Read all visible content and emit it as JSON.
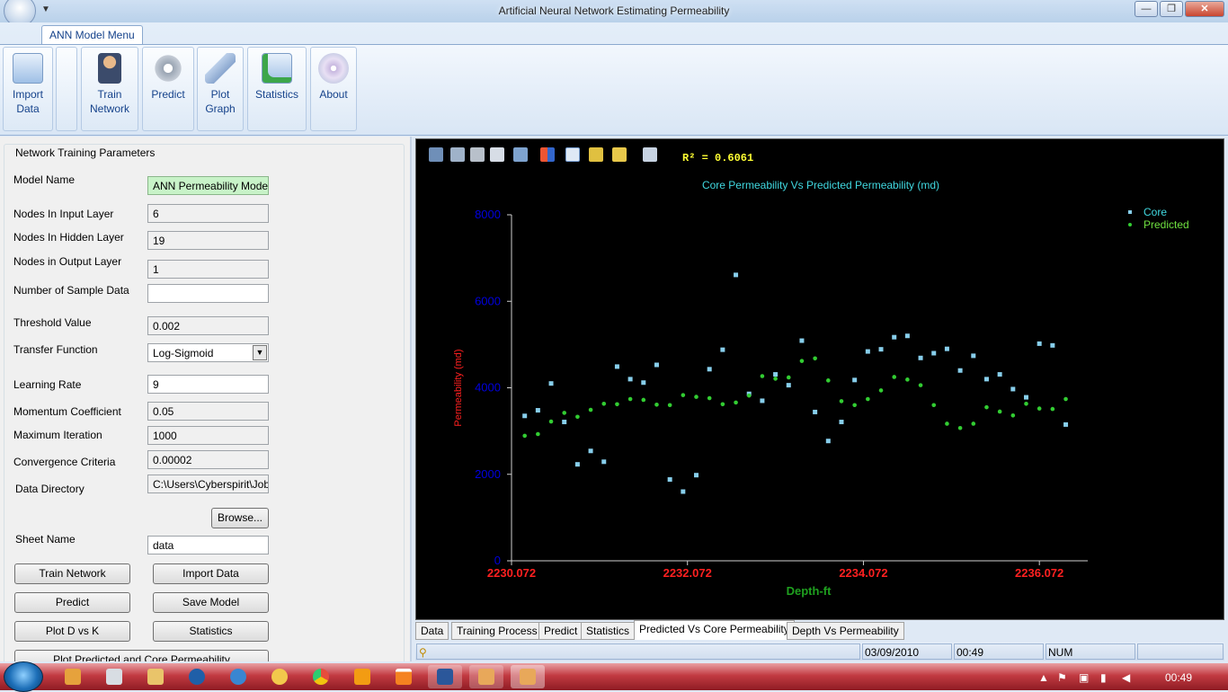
{
  "window": {
    "title": "Artificial Neural Network Estimating Permeability",
    "qat": "▼",
    "minimize": "—",
    "maximize": "❐",
    "close": "✕"
  },
  "ribbon": {
    "tab_label": "ANN Model Menu",
    "buttons": [
      {
        "label": "Import\nData",
        "icon": "envelope-icon"
      },
      {
        "label": "",
        "icon": ""
      },
      {
        "label": "Train\nNetwork",
        "icon": "person-icon"
      },
      {
        "label": "Predict",
        "icon": "gear-icon"
      },
      {
        "label": "Plot\nGraph",
        "icon": "usb-drive-icon"
      },
      {
        "label": "Statistics",
        "icon": "mail-upload-icon"
      },
      {
        "label": "About",
        "icon": "disc-icon"
      }
    ]
  },
  "params": {
    "group_title": "Network Training Parameters",
    "model_name": {
      "label": "Model Name",
      "value": "ANN Permeability Model"
    },
    "input_layer": {
      "label": "Nodes In Input Layer",
      "value": "6"
    },
    "hidden_layer": {
      "label": "Nodes In Hidden Layer",
      "value": "19"
    },
    "output_layer": {
      "label": "Nodes in Output Layer",
      "value": "1"
    },
    "sample_data": {
      "label": "Number of  Sample Data",
      "value": ""
    },
    "threshold": {
      "label": "Threshold Value",
      "value": "0.002"
    },
    "transfer": {
      "label": "Transfer Function",
      "value": "Log-Sigmoid"
    },
    "learning_rate": {
      "label": "Learning Rate",
      "value": "9"
    },
    "momentum": {
      "label": "Momentum Coefficient",
      "value": "0.05"
    },
    "max_iter": {
      "label": "Maximum Iteration",
      "value": "1000"
    },
    "convergence": {
      "label": "Convergence Criteria",
      "value": "0.00002"
    },
    "data_dir": {
      "label": "Data Directory",
      "value": "C:\\Users\\Cyberspirit\\Job"
    },
    "browse": "Browse...",
    "sheet_name": {
      "label": "Sheet Name",
      "value": "data"
    },
    "buttons": {
      "train": "Train Network",
      "import": "Import Data",
      "predict": "Predict",
      "save": "Save Model",
      "plot": "Plot D vs K",
      "statistics": "Statistics",
      "plot_predicted": "Plot Predicted and Core Permeability"
    }
  },
  "chart_header": {
    "r2": "R² = 0.6061",
    "title": "Core Permeability Vs Predicted Permeability (md)"
  },
  "chart_data": {
    "type": "scatter",
    "title": "Core Permeability Vs Predicted Permeability (md)",
    "xlabel": "Depth-ft",
    "ylabel": "Permeability (md)",
    "xlim": [
      2230.072,
      2236.622
    ],
    "ylim": [
      0,
      8000
    ],
    "xticks": [
      "2230.072",
      "2232.072",
      "2234.072",
      "2236.072"
    ],
    "yticks": [
      "0",
      "2000",
      "4000",
      "6000",
      "8000"
    ],
    "legend_position": "top-right",
    "series": [
      {
        "name": "Core",
        "color": "#87ceeb",
        "marker": "square",
        "x": [
          2230.222,
          2230.372,
          2230.522,
          2230.672,
          2230.822,
          2230.972,
          2231.122,
          2231.272,
          2231.422,
          2231.572,
          2231.722,
          2231.872,
          2232.022,
          2232.172,
          2232.322,
          2232.472,
          2232.622,
          2232.772,
          2232.922,
          2233.072,
          2233.222,
          2233.372,
          2233.522,
          2233.672,
          2233.822,
          2233.972,
          2234.122,
          2234.272,
          2234.422,
          2234.572,
          2234.722,
          2234.872,
          2235.022,
          2235.172,
          2235.322,
          2235.472,
          2235.622,
          2235.772,
          2235.922,
          2236.072,
          2236.222,
          2236.372
        ],
        "y": [
          3350,
          3480,
          4100,
          3210,
          2230,
          2540,
          2290,
          4490,
          4200,
          4120,
          4530,
          1880,
          1600,
          1980,
          4430,
          4880,
          6610,
          3860,
          3700,
          4310,
          4060,
          5090,
          3440,
          2770,
          3210,
          4180,
          4840,
          4890,
          5170,
          5200,
          4690,
          4800,
          4900,
          4400,
          4740,
          4200,
          4310,
          3970,
          3780,
          5020,
          4980,
          3150
        ]
      },
      {
        "name": "Predicted",
        "color": "#32cd32",
        "marker": "circle",
        "x": [
          2230.222,
          2230.372,
          2230.522,
          2230.672,
          2230.822,
          2230.972,
          2231.122,
          2231.272,
          2231.422,
          2231.572,
          2231.722,
          2231.872,
          2232.022,
          2232.172,
          2232.322,
          2232.472,
          2232.622,
          2232.772,
          2232.922,
          2233.072,
          2233.222,
          2233.372,
          2233.522,
          2233.672,
          2233.822,
          2233.972,
          2234.122,
          2234.272,
          2234.422,
          2234.572,
          2234.722,
          2234.872,
          2235.022,
          2235.172,
          2235.322,
          2235.472,
          2235.622,
          2235.772,
          2235.922,
          2236.072,
          2236.222,
          2236.372
        ],
        "y": [
          2890,
          2930,
          3220,
          3420,
          3330,
          3490,
          3630,
          3620,
          3740,
          3720,
          3610,
          3600,
          3830,
          3790,
          3760,
          3620,
          3660,
          3820,
          4270,
          4210,
          4240,
          4620,
          4680,
          4170,
          3690,
          3600,
          3740,
          3940,
          4250,
          4190,
          4060,
          3600,
          3170,
          3070,
          3170,
          3550,
          3450,
          3360,
          3630,
          3520,
          3510,
          3740
        ]
      }
    ]
  },
  "tabs": [
    "Data",
    "Training Process",
    "Predict",
    "Statistics",
    "Predicted Vs Core Permeability",
    "Depth Vs Permeability"
  ],
  "status": {
    "date": "03/09/2010",
    "time": "00:49",
    "num": "NUM"
  },
  "taskbar": {
    "clock": "00:49"
  }
}
